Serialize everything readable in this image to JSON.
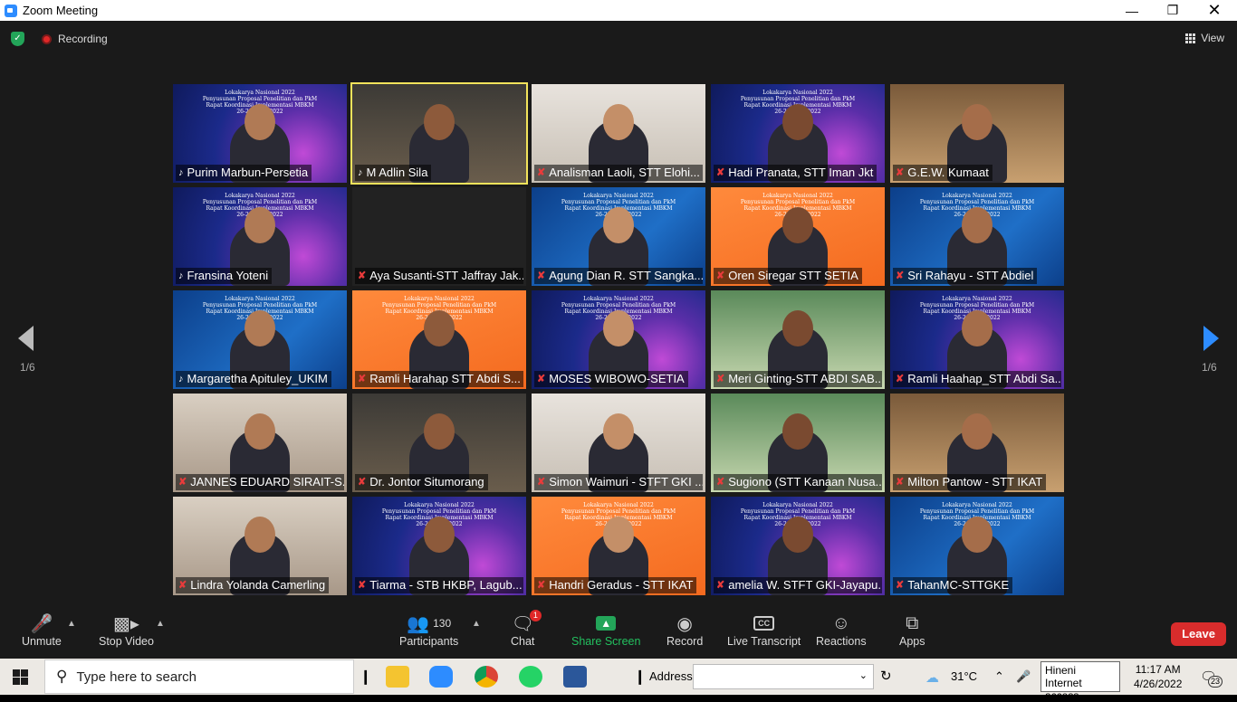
{
  "window": {
    "title": "Zoom Meeting"
  },
  "topbar": {
    "recording_label": "Recording",
    "view_label": "View"
  },
  "pager": {
    "label": "1/6"
  },
  "tiles": [
    {
      "name": "Purim Marbun-Persetia",
      "muted": false,
      "bg": "slide"
    },
    {
      "name": "M Adlin Sila",
      "muted": false,
      "bg": "room",
      "active": true
    },
    {
      "name": "Analisman Laoli, STT Elohi...",
      "muted": true,
      "bg": "room"
    },
    {
      "name": "Hadi Pranata, STT Iman Jkt",
      "muted": true,
      "bg": "slide"
    },
    {
      "name": "G.E.W. Kumaat",
      "muted": true,
      "bg": "room"
    },
    {
      "name": "Fransina Yoteni",
      "muted": false,
      "bg": "slide"
    },
    {
      "name": "Aya Susanti-STT Jaffray Jak...",
      "muted": true,
      "bg": "none"
    },
    {
      "name": "Agung Dian R. STT Sangka...",
      "muted": true,
      "bg": "blue"
    },
    {
      "name": "Oren Siregar STT SETIA",
      "muted": true,
      "bg": "orange"
    },
    {
      "name": "Sri Rahayu - STT Abdiel",
      "muted": true,
      "bg": "blue"
    },
    {
      "name": "Margaretha Apituley_UKIM",
      "muted": false,
      "bg": "blue"
    },
    {
      "name": "Ramli Harahap STT Abdi S...",
      "muted": true,
      "bg": "orange"
    },
    {
      "name": "MOSES WIBOWO-SETIA",
      "muted": true,
      "bg": "slide"
    },
    {
      "name": "Meri Ginting-STT ABDI SAB...",
      "muted": true,
      "bg": "room"
    },
    {
      "name": "Ramli Haahap_STT Abdi Sa...",
      "muted": true,
      "bg": "slide"
    },
    {
      "name": "JANNES EDUARD SIRAIT-S...",
      "muted": true,
      "bg": "room"
    },
    {
      "name": "Dr. Jontor Situmorang",
      "muted": true,
      "bg": "room"
    },
    {
      "name": "Simon Waimuri - STFT GKI ...",
      "muted": true,
      "bg": "room"
    },
    {
      "name": "Sugiono (STT Kanaan Nusa...",
      "muted": true,
      "bg": "room"
    },
    {
      "name": "Milton Pantow - STT IKAT",
      "muted": true,
      "bg": "room"
    },
    {
      "name": "Lindra Yolanda Camerling",
      "muted": true,
      "bg": "room"
    },
    {
      "name": "Tiarma - STB HKBP, Lagub...",
      "muted": true,
      "bg": "slide"
    },
    {
      "name": "Handri Geradus - STT IKAT",
      "muted": true,
      "bg": "orange"
    },
    {
      "name": "amelia W. STFT GKI-Jayapu...",
      "muted": true,
      "bg": "slide"
    },
    {
      "name": "TahanMC-STTGKE",
      "muted": true,
      "bg": "blue"
    }
  ],
  "slide_text": {
    "line1": "Lokakarya Nasional 2022",
    "line2": "Penyusunan Proposal Penelitian dan PkM",
    "line3": "Rapat Koordinasi Implementasi MBKM",
    "line4": "26-28 April 2022"
  },
  "toolbar": {
    "unmute": "Unmute",
    "stop_video": "Stop Video",
    "participants": "Participants",
    "participants_count": "130",
    "chat": "Chat",
    "chat_badge": "1",
    "share_screen": "Share Screen",
    "record": "Record",
    "live_transcript": "Live Transcript",
    "reactions": "Reactions",
    "apps": "Apps",
    "leave": "Leave"
  },
  "taskbar": {
    "search_placeholder": "Type here to search",
    "address_label": "Address",
    "weather": "31°C",
    "tooltip_line1": "Hineni",
    "tooltip_line2": "Internet access",
    "time": "11:17 AM",
    "date": "4/26/2022",
    "notif_count": "23"
  },
  "colors": {
    "accent": "#2d8cff",
    "leave": "#d92c2c",
    "active_speaker": "#f2e35b",
    "share": "#23a559"
  }
}
